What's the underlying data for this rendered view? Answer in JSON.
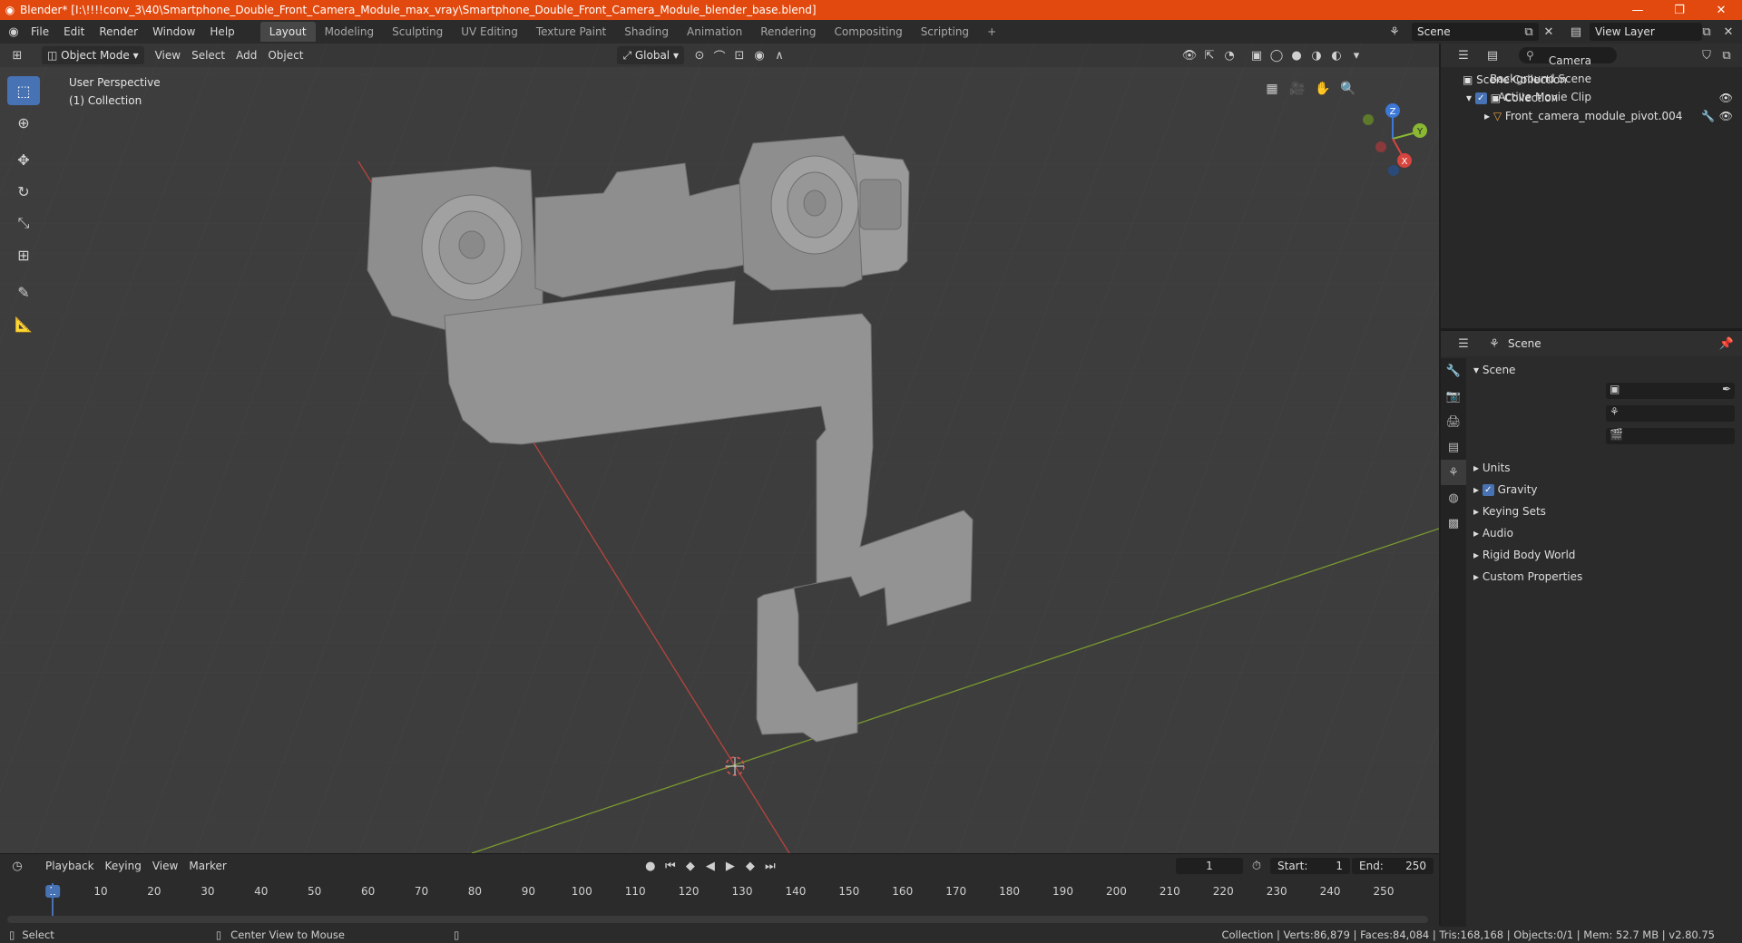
{
  "window": {
    "title": "Blender* [I:\\!!!!conv_3\\40\\Smartphone_Double_Front_Camera_Module_max_vray\\Smartphone_Double_Front_Camera_Module_blender_base.blend]",
    "minimize": "—",
    "maximize": "❐",
    "close": "✕"
  },
  "menu": [
    "File",
    "Edit",
    "Render",
    "Window",
    "Help"
  ],
  "workspaces": [
    "Layout",
    "Modeling",
    "Sculpting",
    "UV Editing",
    "Texture Paint",
    "Shading",
    "Animation",
    "Rendering",
    "Compositing",
    "Scripting"
  ],
  "active_workspace": "Layout",
  "add_workspace": "+",
  "scene_field": "Scene",
  "view_layer_field": "View Layer",
  "viewport": {
    "mode": "Object Mode",
    "menus": [
      "View",
      "Select",
      "Add",
      "Object"
    ],
    "transform": "Global",
    "info_perspective": "User Perspective",
    "info_collection": "(1) Collection",
    "gizmo": {
      "x": "X",
      "y": "Y",
      "z": "Z"
    }
  },
  "timeline": {
    "menus": [
      "Playback",
      "Keying",
      "View",
      "Marker"
    ],
    "current_frame": "1",
    "start_label": "Start:",
    "start": "1",
    "end_label": "End:",
    "end": "250",
    "ruler": [
      "1",
      "10",
      "20",
      "30",
      "40",
      "50",
      "60",
      "70",
      "80",
      "90",
      "100",
      "110",
      "120",
      "130",
      "140",
      "150",
      "160",
      "170",
      "180",
      "190",
      "200",
      "210",
      "220",
      "230",
      "240",
      "250"
    ]
  },
  "status": {
    "select": "Select",
    "center": "Center View to Mouse",
    "stats": "Collection | Verts:86,879 | Faces:84,084 | Tris:168,168 | Objects:0/1 | Mem: 52.7 MB | v2.80.75"
  },
  "outliner": {
    "scene_collection": "Scene Collection",
    "collection": "Collection",
    "object": "Front_camera_module_pivot.004"
  },
  "properties": {
    "header": "Scene",
    "panel": "Scene",
    "camera_label": "Camera",
    "background_label": "Background Scene",
    "movie_clip_label": "Active Movie Clip",
    "sections": [
      "Units",
      "Gravity",
      "Keying Sets",
      "Audio",
      "Rigid Body World",
      "Custom Properties"
    ]
  },
  "colors": {
    "titlebar": "#e2490e",
    "accent": "#4772b3",
    "x_axis": "#d8443e",
    "y_axis": "#8ab833",
    "z_axis": "#3c78d8"
  }
}
